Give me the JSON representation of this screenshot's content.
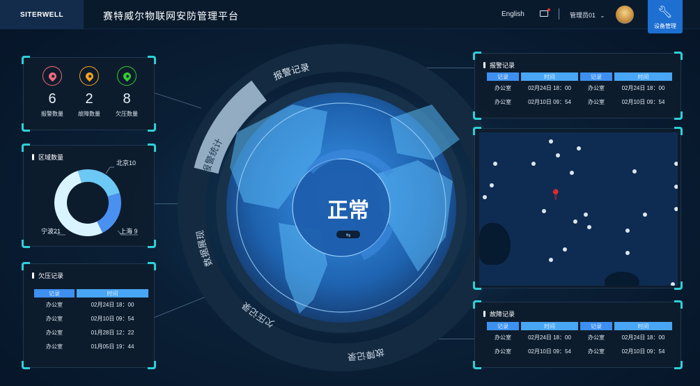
{
  "header": {
    "logo": "SITERWELL",
    "title": "赛特威尔物联网安防管理平台",
    "language": "English",
    "user": "管理员01",
    "device_button": "设备管理",
    "icons": [
      "mail-icon",
      "chevron-down-icon",
      "wrench-icon"
    ]
  },
  "stats": [
    {
      "label": "报警数量",
      "value": "6",
      "color": "#f06a7d"
    },
    {
      "label": "故障数量",
      "value": "2",
      "color": "#f5a321"
    },
    {
      "label": "欠压数量",
      "value": "8",
      "color": "#33cc33"
    }
  ],
  "region": {
    "title": "区域数量",
    "items": [
      {
        "name": "北京",
        "value": 10,
        "color": "#6cc8f5",
        "label": "北京10"
      },
      {
        "name": "上海",
        "value": 9,
        "color": "#4a90f0",
        "label": "上海 9"
      },
      {
        "name": "宁波",
        "value": 21,
        "color": "#d9f4ff",
        "label": "宁波21"
      }
    ]
  },
  "undervoltage": {
    "title": "欠压记录",
    "headers": [
      "记录",
      "时间"
    ],
    "rows": [
      [
        "办公室",
        "02月24日 18：00"
      ],
      [
        "办公室",
        "02月10日 09：54"
      ],
      [
        "办公室",
        "01月28日 12：22"
      ],
      [
        "办公室",
        "01月05日 19：44"
      ]
    ]
  },
  "alarm": {
    "title": "报警记录",
    "headers": [
      "记录",
      "时间",
      "记录",
      "时间"
    ],
    "rows": [
      [
        "办公室",
        "02月24日 18：00",
        "办公室",
        "02月24日 18：00"
      ],
      [
        "办公室",
        "02月10日 09：54",
        "办公室",
        "02月10日 09：54"
      ]
    ]
  },
  "fault": {
    "title": "故障记录",
    "headers": [
      "记录",
      "时间",
      "记录",
      "时间"
    ],
    "rows": [
      [
        "办公室",
        "02月24日 18：00",
        "办公室",
        "02月24日 18：00"
      ],
      [
        "办公室",
        "02月10日 09：54",
        "办公室",
        "02月10日 09：54"
      ]
    ]
  },
  "center": {
    "status": "正常",
    "ring": [
      "报警记录",
      "报警统计",
      "数据展现",
      "欠压记录",
      "故障记录"
    ],
    "active": "报警统计"
  }
}
